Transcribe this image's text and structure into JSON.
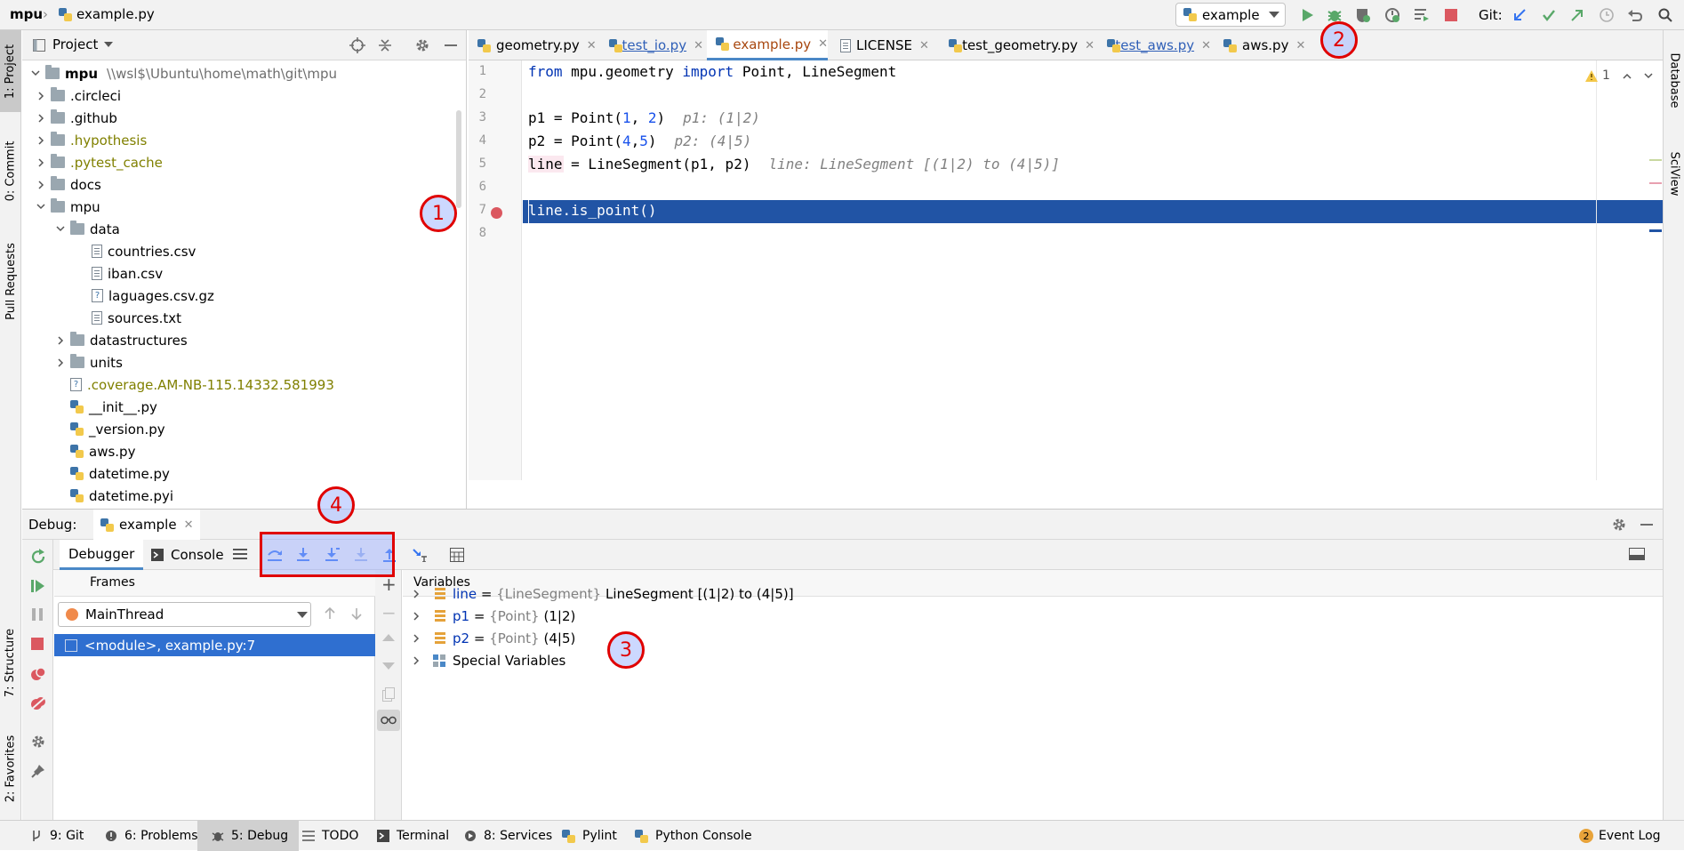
{
  "titlebar": {
    "project": "mpu",
    "file": "example.py"
  },
  "run_config": {
    "label": "example"
  },
  "git_label": "Git:",
  "left_tabs": [
    "1: Project",
    "0: Commit",
    "Pull Requests",
    "7: Structure",
    "2: Favorites"
  ],
  "right_tabs": [
    "Database",
    "SciView"
  ],
  "project_panel": {
    "title": "Project",
    "root": {
      "name": "mpu",
      "path": "\\\\wsl$\\Ubuntu\\home\\math\\git\\mpu"
    },
    "items": [
      {
        "label": ".circleci",
        "kind": "folder"
      },
      {
        "label": ".github",
        "kind": "folder"
      },
      {
        "label": ".hypothesis",
        "kind": "folder",
        "color": "#808000"
      },
      {
        "label": ".pytest_cache",
        "kind": "folder",
        "color": "#808000"
      },
      {
        "label": "docs",
        "kind": "folder"
      },
      {
        "label": "mpu",
        "kind": "folder"
      },
      {
        "label": "data",
        "kind": "folder"
      },
      {
        "label": "countries.csv",
        "kind": "file"
      },
      {
        "label": "iban.csv",
        "kind": "file"
      },
      {
        "label": "laguages.csv.gz",
        "kind": "unknown"
      },
      {
        "label": "sources.txt",
        "kind": "file"
      },
      {
        "label": "datastructures",
        "kind": "folder"
      },
      {
        "label": "units",
        "kind": "folder"
      },
      {
        "label": ".coverage.AM-NB-115.14332.581993",
        "kind": "unknown",
        "color": "#808000"
      },
      {
        "label": "__init__.py",
        "kind": "py"
      },
      {
        "label": "_version.py",
        "kind": "py"
      },
      {
        "label": "aws.py",
        "kind": "py"
      },
      {
        "label": "datetime.py",
        "kind": "py"
      },
      {
        "label": "datetime.pyi",
        "kind": "py"
      }
    ]
  },
  "editor_tabs": [
    "geometry.py",
    "test_io.py",
    "example.py",
    "LICENSE",
    "test_geometry.py",
    "test_aws.py",
    "aws.py"
  ],
  "editor": {
    "warning_count": "1",
    "line_numbers": [
      "1",
      "2",
      "3",
      "4",
      "5",
      "6",
      "7",
      "8"
    ],
    "lines": [
      {
        "code": "from mpu.geometry import Point, LineSegment",
        "hint": ""
      },
      {
        "code": "",
        "hint": ""
      },
      {
        "code": "p1 = Point(1, 2)",
        "hint": "p1: (1|2)"
      },
      {
        "code": "p2 = Point(4,5)",
        "hint": "p2: (4|5)"
      },
      {
        "code": "line = LineSegment(p1, p2)",
        "hint": "line: LineSegment [(1|2) to (4|5)]"
      },
      {
        "code": "",
        "hint": ""
      },
      {
        "code": "line.is_point()",
        "hint": ""
      },
      {
        "code": "",
        "hint": ""
      }
    ]
  },
  "debug": {
    "label": "Debug:",
    "session": "example",
    "tabs": {
      "debugger": "Debugger",
      "console": "Console"
    },
    "frames_title": "Frames",
    "thread": "MainThread",
    "frames": [
      "<module>, example.py:7"
    ],
    "variables_title": "Variables",
    "variables": [
      {
        "name": "line",
        "type": "{LineSegment}",
        "value": "LineSegment [(1|2) to (4|5)]"
      },
      {
        "name": "p1",
        "type": "{Point}",
        "value": "(1|2)"
      },
      {
        "name": "p2",
        "type": "{Point}",
        "value": "(4|5)"
      }
    ],
    "special": "Special Variables"
  },
  "markers": [
    "1",
    "2",
    "3",
    "4"
  ],
  "statusbar": {
    "items": [
      "9: Git",
      "6: Problems",
      "5: Debug",
      "TODO",
      "Terminal",
      "8: Services",
      "Pylint",
      "Python Console"
    ],
    "event_log": "Event Log",
    "event_count": "2"
  }
}
